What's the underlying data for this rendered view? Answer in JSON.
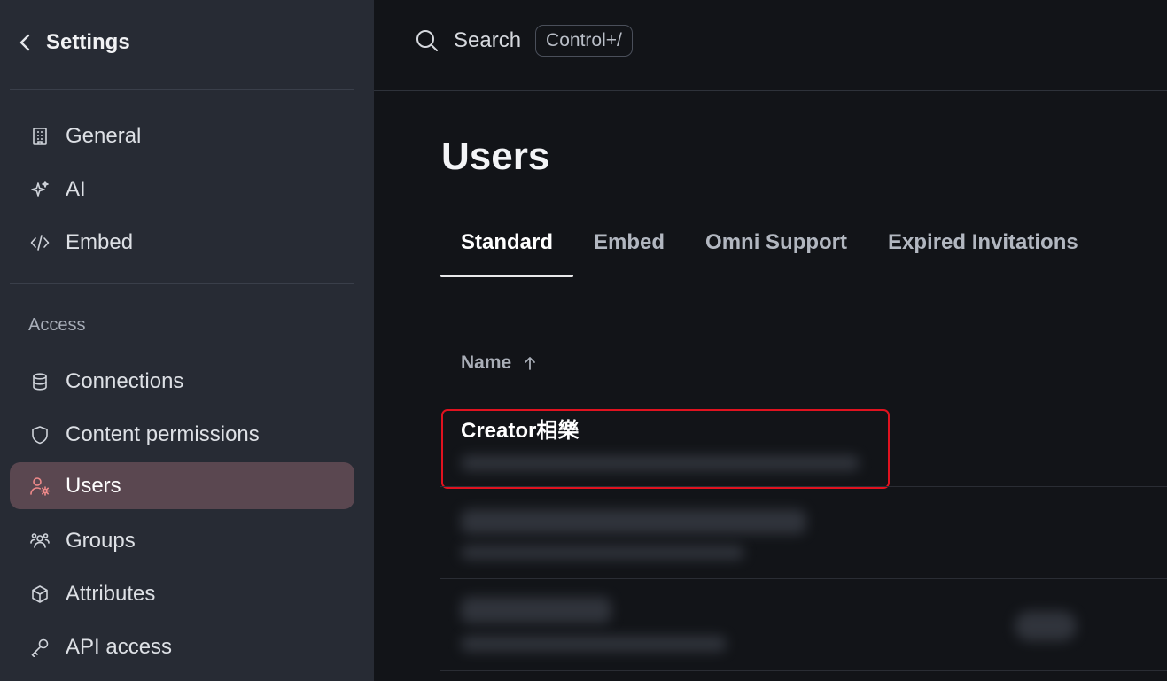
{
  "sidebar": {
    "title": "Settings",
    "top_items": [
      {
        "label": "General",
        "icon": "building-icon"
      },
      {
        "label": "AI",
        "icon": "sparkles-icon"
      },
      {
        "label": "Embed",
        "icon": "code-icon"
      }
    ],
    "access_section_label": "Access",
    "access_items": [
      {
        "label": "Connections",
        "icon": "database-icon"
      },
      {
        "label": "Content permissions",
        "icon": "shield-icon"
      },
      {
        "label": "Users",
        "icon": "user-gear-icon",
        "active": true
      },
      {
        "label": "Groups",
        "icon": "users-group-icon"
      },
      {
        "label": "Attributes",
        "icon": "cube-icon"
      },
      {
        "label": "API access",
        "icon": "key-icon"
      }
    ]
  },
  "topbar": {
    "search_label": "Search",
    "shortcut": "Control+/"
  },
  "main": {
    "title": "Users",
    "tabs": [
      {
        "label": "Standard",
        "active": true
      },
      {
        "label": "Embed"
      },
      {
        "label": "Omni Support"
      },
      {
        "label": "Expired Invitations"
      }
    ],
    "table": {
      "column_name": "Name",
      "rows": [
        {
          "name": "Creator相樂"
        }
      ]
    }
  },
  "colors": {
    "sidebar_bg": "#272b34",
    "main_bg": "#121418",
    "active_item_bg": "#5a4750",
    "active_icon": "#f08a8a",
    "highlight_border": "#e0121f"
  }
}
